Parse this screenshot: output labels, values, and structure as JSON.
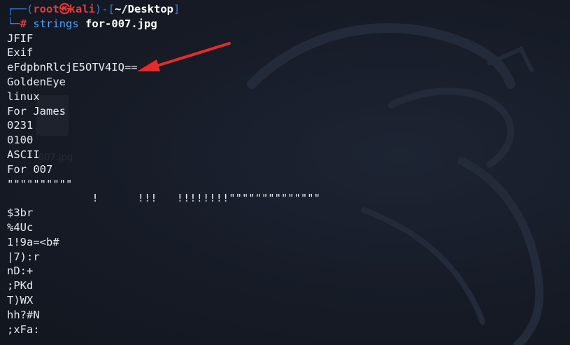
{
  "prompt": {
    "open_bracket": "(",
    "user": "root",
    "at_symbol": "㉿",
    "host": "kali",
    "close_bracket": ")",
    "separator": "-[",
    "cwd": "~/Desktop",
    "cwd_close": "]",
    "hash": "#",
    "command": "strings",
    "argument": "for-007.jpg"
  },
  "output_lines": [
    "JFIF",
    "Exif",
    "eFdpbnRlcjE5OTV4IQ==",
    "GoldenEye",
    "linux",
    "For James",
    "0231",
    "0100",
    "ASCII",
    "For 007",
    "\"\"\"\"\"\"\"\"\"\"",
    "             !      !!!   !!!!!!!!\"\"\"\"\"\"\"\"\"\"\"\"\"\"",
    "$3br",
    "%4Uc",
    "1!9a=<b#",
    "|7):r",
    "nD:+",
    ";PKd",
    "T)WX",
    "hh?#N",
    ";xFa:"
  ],
  "desktop_ghost_label": "007.jpg",
  "colors": {
    "background": "#161b26",
    "prompt_frame": "#3a7bd5",
    "user_host": "#e23b3b",
    "command": "#4fa3ff",
    "text": "#e8eaef",
    "arrow": "#e52b2b"
  }
}
